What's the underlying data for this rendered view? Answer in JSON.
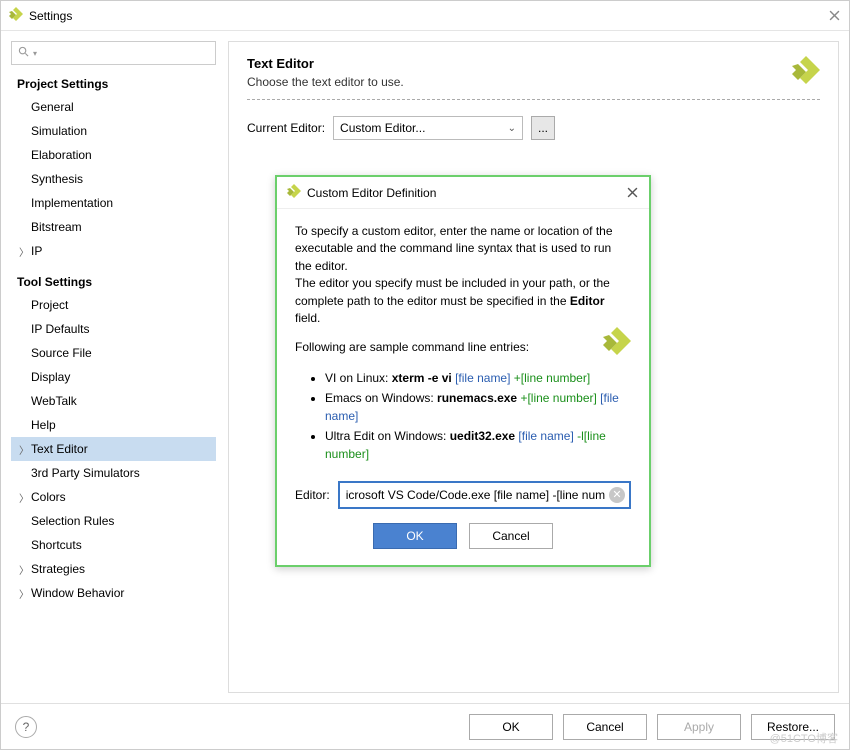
{
  "window": {
    "title": "Settings"
  },
  "search": {
    "placeholder": ""
  },
  "sections": {
    "project": {
      "title": "Project Settings",
      "items": [
        {
          "label": "General",
          "expandable": false
        },
        {
          "label": "Simulation",
          "expandable": false
        },
        {
          "label": "Elaboration",
          "expandable": false
        },
        {
          "label": "Synthesis",
          "expandable": false
        },
        {
          "label": "Implementation",
          "expandable": false
        },
        {
          "label": "Bitstream",
          "expandable": false
        },
        {
          "label": "IP",
          "expandable": true
        }
      ]
    },
    "tool": {
      "title": "Tool Settings",
      "items": [
        {
          "label": "Project",
          "expandable": false
        },
        {
          "label": "IP Defaults",
          "expandable": false
        },
        {
          "label": "Source File",
          "expandable": false
        },
        {
          "label": "Display",
          "expandable": false
        },
        {
          "label": "WebTalk",
          "expandable": false
        },
        {
          "label": "Help",
          "expandable": false
        },
        {
          "label": "Text Editor",
          "expandable": true,
          "selected": true
        },
        {
          "label": "3rd Party Simulators",
          "expandable": false
        },
        {
          "label": "Colors",
          "expandable": true
        },
        {
          "label": "Selection Rules",
          "expandable": false
        },
        {
          "label": "Shortcuts",
          "expandable": false
        },
        {
          "label": "Strategies",
          "expandable": true
        },
        {
          "label": "Window Behavior",
          "expandable": true
        }
      ]
    }
  },
  "main": {
    "title": "Text Editor",
    "subtitle": "Choose the text editor to use.",
    "current_label": "Current Editor:",
    "current_value": "Custom Editor...",
    "ellipsis": "..."
  },
  "modal": {
    "title": "Custom Editor Definition",
    "p1a": "To specify a custom editor, enter the name or location of the executable and the command line syntax that is used to run the editor.",
    "p1b": "The editor you specify must be included in your path, or the complete path to the editor must be specified in the ",
    "p1c": "Editor",
    "p1d": " field.",
    "p2": "Following are sample command line entries:",
    "li1_a": "VI on Linux: ",
    "li1_b": "xterm -e vi",
    "li1_c": " [file name]",
    "li1_d": " +[line number]",
    "li2_a": "Emacs on Windows: ",
    "li2_b": "runemacs.exe",
    "li2_c": " +[line number]",
    "li2_d": " [file name]",
    "li3_a": "Ultra Edit on Windows: ",
    "li3_b": "uedit32.exe",
    "li3_c": " [file name]",
    "li3_d": " -l[line number]",
    "editor_label": "Editor:",
    "editor_value": "icrosoft VS Code/Code.exe [file name] -[line num",
    "ok": "OK",
    "cancel": "Cancel"
  },
  "footer": {
    "ok": "OK",
    "cancel": "Cancel",
    "apply": "Apply",
    "restore": "Restore..."
  },
  "watermark": "@51CTO博客"
}
